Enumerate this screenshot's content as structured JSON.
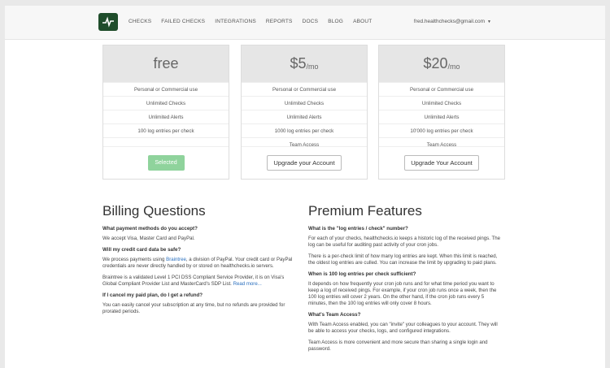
{
  "nav": {
    "items": [
      "CHECKS",
      "FAILED CHECKS",
      "INTEGRATIONS",
      "REPORTS",
      "DOCS",
      "BLOG",
      "ABOUT"
    ],
    "user": "fred.healthchecks@gmail.com"
  },
  "plans": [
    {
      "name": "free",
      "price_suffix": "",
      "features": [
        "Personal or Commercial use",
        "Unlimited Checks",
        "Unlimited Alerts",
        "100 log entries per check",
        ""
      ],
      "button": "Selected"
    },
    {
      "name": "$5",
      "price_suffix": "/mo",
      "features": [
        "Personal or Commercial use",
        "Unlimited Checks",
        "Unlimited Alerts",
        "1000 log entries per check",
        "Team Access"
      ],
      "button": "Upgrade your Account"
    },
    {
      "name": "$20",
      "price_suffix": "/mo",
      "features": [
        "Personal or Commercial use",
        "Unlimited Checks",
        "Unlimited Alerts",
        "10'000 log entries per check",
        "Team Access"
      ],
      "button": "Upgrade Your Account"
    }
  ],
  "billing": {
    "title": "Billing Questions",
    "q1": "What payment methods do you accept?",
    "a1": "We accept Visa, Master Card and PayPal.",
    "q2": "Will my credit card data be safe?",
    "a2_pre": "We process payments using ",
    "a2_link": "Braintree",
    "a2_post": ", a division of PayPal. Your credit card or PayPal credentials are never directly handled by or stored on healthchecks.io servers.",
    "a2b": "Braintree is a validated Level 1 PCI DSS Compliant Service Provider, it is on Visa's Global Compliant Provider List and MasterCard's SDP List. ",
    "a2b_link": "Read more...",
    "q3": "If I cancel my paid plan, do I get a refund?",
    "a3": "You can easily cancel your subscription at any time, but no refunds are provided for prorated periods."
  },
  "premium": {
    "title": "Premium Features",
    "q1": "What is the \"log entries / check\" number?",
    "a1a": "For each of your checks, healthchecks.io keeps a historic log of the received pings. The log can be useful for auditing past activity of your cron jobs.",
    "a1b": "There is a per-check limit of how many log entries are kept. When this limit is reached, the oldest log entries are culled. You can increase the limit by upgrading to paid plans.",
    "q2": "When is 100 log entries per check sufficient?",
    "a2": "It depends on how frequently your cron job runs and for what time period you want to keep a log of received pings. For example, if your cron job runs once a week, then the 100 log entries will cover 2 years. On the other hand, if the cron job runs every 5 minutes, then the 100 log entries will only cover 8 hours.",
    "q3": "What's Team Access?",
    "a3a": "With Team Access enabled, you can \"invite\" your colleagues to your account. They will be able to access your checks, logs, and configured integrations.",
    "a3b": "Team Access is more convenient and more secure than sharing a single login and password."
  }
}
